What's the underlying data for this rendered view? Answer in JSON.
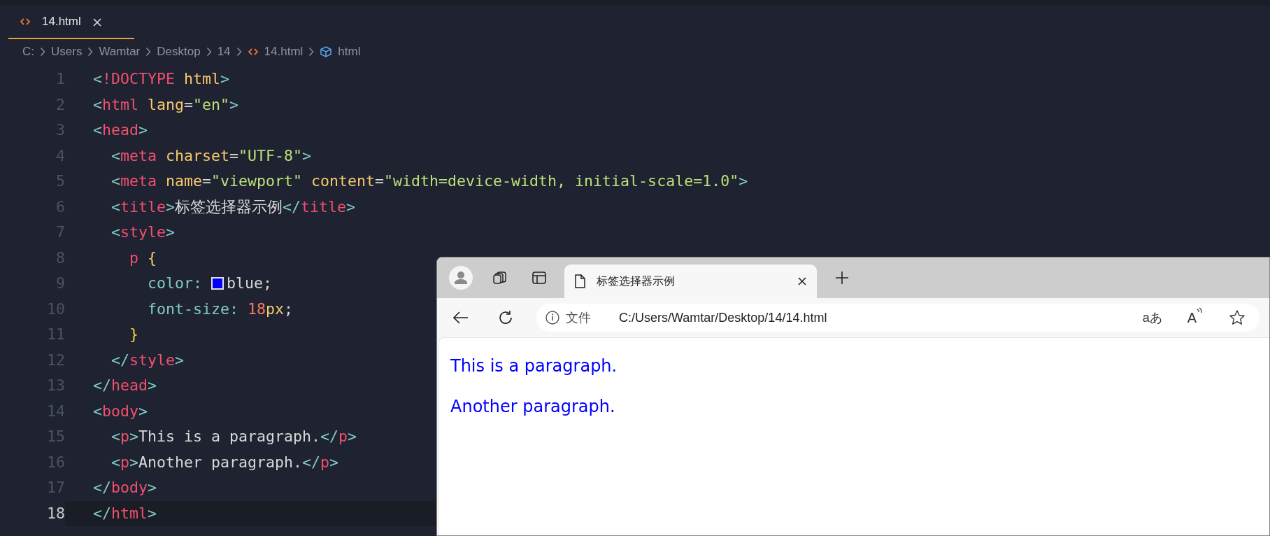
{
  "editor": {
    "tab": {
      "label": "14.html",
      "selected": true
    },
    "breadcrumb": [
      {
        "kind": "folder",
        "label": "C:"
      },
      {
        "kind": "folder",
        "label": "Users"
      },
      {
        "kind": "folder",
        "label": "Wamtar"
      },
      {
        "kind": "folder",
        "label": "Desktop"
      },
      {
        "kind": "folder",
        "label": "14"
      },
      {
        "kind": "file",
        "label": "14.html"
      },
      {
        "kind": "symbol",
        "label": "html"
      }
    ],
    "lines": [
      {
        "number": "1",
        "selected": false,
        "tokens": [
          {
            "kind": "punct",
            "text": "<"
          },
          {
            "kind": "tag",
            "text": "!DOCTYPE"
          },
          {
            "kind": "attr",
            "text": " html"
          },
          {
            "kind": "punct",
            "text": ">"
          }
        ]
      },
      {
        "number": "2",
        "selected": false,
        "tokens": [
          {
            "kind": "punct",
            "text": "<"
          },
          {
            "kind": "tag",
            "text": "html"
          },
          {
            "kind": "attr",
            "text": " lang"
          },
          {
            "kind": "plain",
            "text": "="
          },
          {
            "kind": "string",
            "text": "\"en\""
          },
          {
            "kind": "punct",
            "text": ">"
          }
        ]
      },
      {
        "number": "3",
        "selected": false,
        "tokens": [
          {
            "kind": "punct",
            "text": "<"
          },
          {
            "kind": "tag",
            "text": "head"
          },
          {
            "kind": "punct",
            "text": ">"
          }
        ]
      },
      {
        "number": "4",
        "selected": false,
        "tokens": [
          {
            "kind": "punct",
            "text": "  <"
          },
          {
            "kind": "tag",
            "text": "meta"
          },
          {
            "kind": "attr",
            "text": " charset"
          },
          {
            "kind": "plain",
            "text": "="
          },
          {
            "kind": "string",
            "text": "\"UTF-8\""
          },
          {
            "kind": "punct",
            "text": ">"
          }
        ]
      },
      {
        "number": "5",
        "selected": false,
        "tokens": [
          {
            "kind": "punct",
            "text": "  <"
          },
          {
            "kind": "tag",
            "text": "meta"
          },
          {
            "kind": "attr",
            "text": " name"
          },
          {
            "kind": "plain",
            "text": "="
          },
          {
            "kind": "string",
            "text": "\"viewport\""
          },
          {
            "kind": "attr",
            "text": " content"
          },
          {
            "kind": "plain",
            "text": "="
          },
          {
            "kind": "string",
            "text": "\"width=device-width, initial-scale=1.0\""
          },
          {
            "kind": "punct",
            "text": ">"
          }
        ]
      },
      {
        "number": "6",
        "selected": false,
        "tokens": [
          {
            "kind": "punct",
            "text": "  <"
          },
          {
            "kind": "tag",
            "text": "title"
          },
          {
            "kind": "punct",
            "text": ">"
          },
          {
            "kind": "plain",
            "text": "标签选择器示例"
          },
          {
            "kind": "punct",
            "text": "</"
          },
          {
            "kind": "tag",
            "text": "title"
          },
          {
            "kind": "punct",
            "text": ">"
          }
        ]
      },
      {
        "number": "7",
        "selected": false,
        "tokens": [
          {
            "kind": "punct",
            "text": "  <"
          },
          {
            "kind": "tag",
            "text": "style"
          },
          {
            "kind": "punct",
            "text": ">"
          }
        ]
      },
      {
        "number": "8",
        "selected": false,
        "tokens": [
          {
            "kind": "tag",
            "text": "    p"
          },
          {
            "kind": "attr",
            "text": " {"
          }
        ]
      },
      {
        "number": "9",
        "selected": false,
        "tokens": [
          {
            "kind": "punct",
            "text": "      color: "
          },
          {
            "kind": "swatch",
            "color": "#0000ff"
          },
          {
            "kind": "plain",
            "text": "blue;"
          }
        ]
      },
      {
        "number": "10",
        "selected": false,
        "tokens": [
          {
            "kind": "punct",
            "text": "      font-size: "
          },
          {
            "kind": "number",
            "text": "18"
          },
          {
            "kind": "attr",
            "text": "px"
          },
          {
            "kind": "plain",
            "text": ";"
          }
        ]
      },
      {
        "number": "11",
        "selected": false,
        "tokens": [
          {
            "kind": "brace",
            "text": "    }"
          }
        ]
      },
      {
        "number": "12",
        "selected": false,
        "tokens": [
          {
            "kind": "punct",
            "text": "  </"
          },
          {
            "kind": "tag",
            "text": "style"
          },
          {
            "kind": "punct",
            "text": ">"
          }
        ]
      },
      {
        "number": "13",
        "selected": false,
        "tokens": [
          {
            "kind": "punct",
            "text": "</"
          },
          {
            "kind": "tag",
            "text": "head"
          },
          {
            "kind": "punct",
            "text": ">"
          }
        ]
      },
      {
        "number": "14",
        "selected": false,
        "tokens": [
          {
            "kind": "punct",
            "text": "<"
          },
          {
            "kind": "tag",
            "text": "body"
          },
          {
            "kind": "punct",
            "text": ">"
          }
        ]
      },
      {
        "number": "15",
        "selected": false,
        "tokens": [
          {
            "kind": "punct",
            "text": "  <"
          },
          {
            "kind": "tag",
            "text": "p"
          },
          {
            "kind": "punct",
            "text": ">"
          },
          {
            "kind": "plain",
            "text": "This is a paragraph."
          },
          {
            "kind": "punct",
            "text": "</"
          },
          {
            "kind": "tag",
            "text": "p"
          },
          {
            "kind": "punct",
            "text": ">"
          }
        ]
      },
      {
        "number": "16",
        "selected": false,
        "tokens": [
          {
            "kind": "punct",
            "text": "  <"
          },
          {
            "kind": "tag",
            "text": "p"
          },
          {
            "kind": "punct",
            "text": ">"
          },
          {
            "kind": "plain",
            "text": "Another paragraph."
          },
          {
            "kind": "punct",
            "text": "</"
          },
          {
            "kind": "tag",
            "text": "p"
          },
          {
            "kind": "punct",
            "text": ">"
          }
        ]
      },
      {
        "number": "17",
        "selected": false,
        "tokens": [
          {
            "kind": "punct",
            "text": "</"
          },
          {
            "kind": "tag",
            "text": "body"
          },
          {
            "kind": "punct",
            "text": ">"
          }
        ]
      },
      {
        "number": "18",
        "selected": true,
        "tokens": [
          {
            "kind": "punct",
            "text": "</"
          },
          {
            "kind": "tag",
            "text": "html"
          },
          {
            "kind": "punct",
            "text": ">"
          }
        ]
      }
    ]
  },
  "browser": {
    "tab": {
      "title": "标签选择器示例",
      "selected": true
    },
    "address": {
      "scheme_label": "文件",
      "url": "C:/Users/Wamtar/Desktop/14/14.html"
    },
    "toolbar_text": {
      "immersive": "aあ",
      "read_aloud": "A"
    },
    "paragraphs": [
      "This is a paragraph.",
      "Another paragraph."
    ]
  }
}
